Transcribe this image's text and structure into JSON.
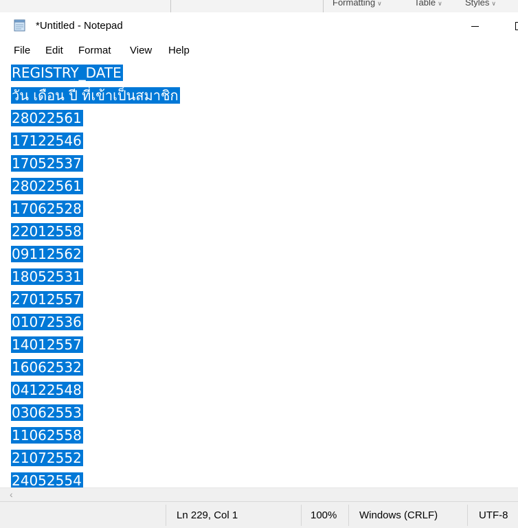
{
  "background_window": {
    "ribbon_items": [
      "Formatting",
      "Table",
      "Styles"
    ]
  },
  "window": {
    "title": "*Untitled - Notepad"
  },
  "menu": {
    "items": [
      "File",
      "Edit",
      "Format",
      "View",
      "Help"
    ]
  },
  "editor": {
    "selection_color": "#0078d7",
    "lines": [
      "REGISTRY_DATE",
      "วัน เดือน ปี ที่เข้าเป็นสมาชิก",
      "28022561",
      "17122546",
      "17052537",
      "28022561",
      "17062528",
      "22012558",
      "09112562",
      "18052531",
      "27012557",
      "01072536",
      "14012557",
      "16062532",
      "04122548",
      "03062553",
      "11062558",
      "21072552",
      "24052554"
    ]
  },
  "statusbar": {
    "position": "Ln 229, Col 1",
    "zoom": "100%",
    "line_ending": "Windows (CRLF)",
    "encoding": "UTF-8"
  }
}
